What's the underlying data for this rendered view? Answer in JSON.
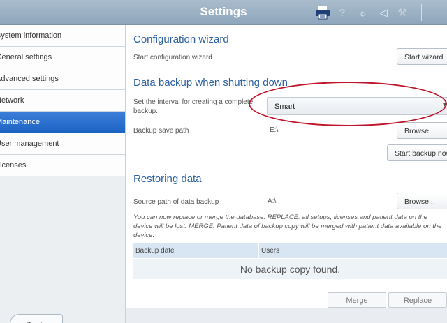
{
  "window": {
    "title": "Settings"
  },
  "sidebar": {
    "items": [
      {
        "label": "System information",
        "active": false
      },
      {
        "label": "General settings",
        "active": false
      },
      {
        "label": "Advanced settings",
        "active": false
      },
      {
        "label": "Network",
        "active": false
      },
      {
        "label": "Maintenance",
        "active": true
      },
      {
        "label": "User management",
        "active": false
      },
      {
        "label": "Licenses",
        "active": false
      }
    ],
    "back_label": "Back"
  },
  "config_wizard": {
    "heading": "Configuration wizard",
    "label": "Start configuration wizard",
    "button": "Start wizard"
  },
  "backup": {
    "heading": "Data backup when shutting down",
    "interval_label": "Set the interval for creating a complete backup.",
    "interval_value": "Smart",
    "save_path_label": "Backup save path",
    "save_path_value": "E:\\",
    "browse_button": "Browse...",
    "start_button": "Start backup now"
  },
  "restore": {
    "heading": "Restoring data",
    "source_label": "Source path of data backup",
    "source_value": "A:\\",
    "browse_button": "Browse...",
    "info": "You can now replace or merge the database. REPLACE: all setups, licenses and patient data on the device will be lost. MERGE: Patient data of backup copy will be merged with patient data available on the device.",
    "table": {
      "columns": [
        "Backup date",
        "Users"
      ],
      "empty_message": "No backup copy found."
    },
    "merge_button": "Merge",
    "replace_button": "Replace"
  },
  "colors": {
    "accent": "#1d63c3",
    "heading": "#2b5fa0",
    "highlight_oval": "#c0142a"
  }
}
